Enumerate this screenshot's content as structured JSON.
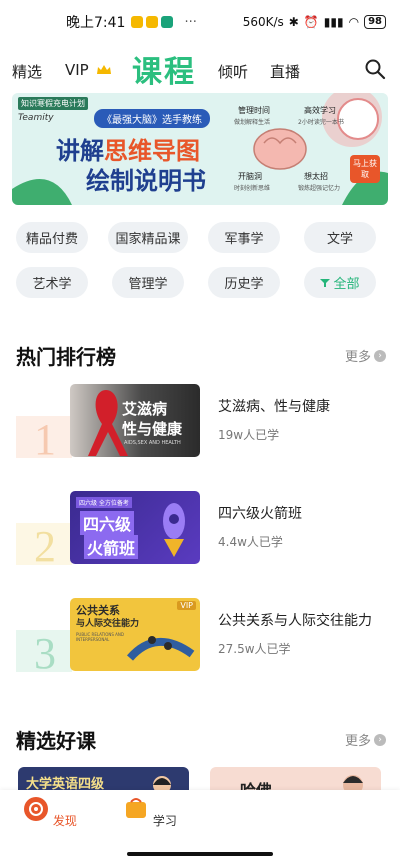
{
  "status": {
    "time": "晚上7:41",
    "dots": "···",
    "speed": "560K/s",
    "battery": "98"
  },
  "nav": {
    "items": [
      "精选",
      "VIP",
      "倾听",
      "直播"
    ],
    "title": "课程"
  },
  "banner": {
    "tag": "知识寒假充电计划",
    "brand": "Teamity",
    "subtitle": "《最强大脑》选手教练",
    "headline1a": "讲解",
    "headline1b": "思维导图",
    "headline2": "绘制说明书",
    "bubbles": [
      "管理时间",
      "高效学习",
      "开脑洞",
      "想太招"
    ],
    "bubble_subs": [
      "做划解释生活",
      "2小时读完一本书",
      "时刻创新思维",
      "锻炼超强记忆力"
    ],
    "cta": "马上获取"
  },
  "tags": [
    "精品付费",
    "国家精品课",
    "军事学",
    "文学",
    "艺术学",
    "管理学",
    "历史学",
    "全部"
  ],
  "hot": {
    "title": "热门排行榜",
    "more": "更多",
    "items": [
      {
        "rank": "1",
        "title": "艾滋病、性与健康",
        "count": "19w人已学",
        "thumb_line1": "艾滋病",
        "thumb_line2": "性与健康",
        "thumb_en": "AIDS,SEX AND HEALTH"
      },
      {
        "rank": "2",
        "title": "四六级火箭班",
        "count": "4.4w人已学",
        "thumb_line1": "四六级",
        "thumb_line2": "火箭班",
        "thumb_top": "四六级 全方位备考"
      },
      {
        "rank": "3",
        "title": "公共关系与人际交往能力",
        "count": "27.5w人已学",
        "thumb_line1": "公共关系",
        "thumb_line2": "与人际交往能力",
        "thumb_badge": "VIP",
        "thumb_en": "PUBLIC RELATIONS AND INTERPERSONAL"
      }
    ]
  },
  "picks": {
    "title": "精选好课",
    "more": "更多",
    "card1": "大学英语四级",
    "card2": "哈佛"
  },
  "tabs": {
    "discover": "发现",
    "study": "学习"
  },
  "colors": {
    "accent": "#2bbf7f",
    "brand_orange": "#e8562a"
  }
}
